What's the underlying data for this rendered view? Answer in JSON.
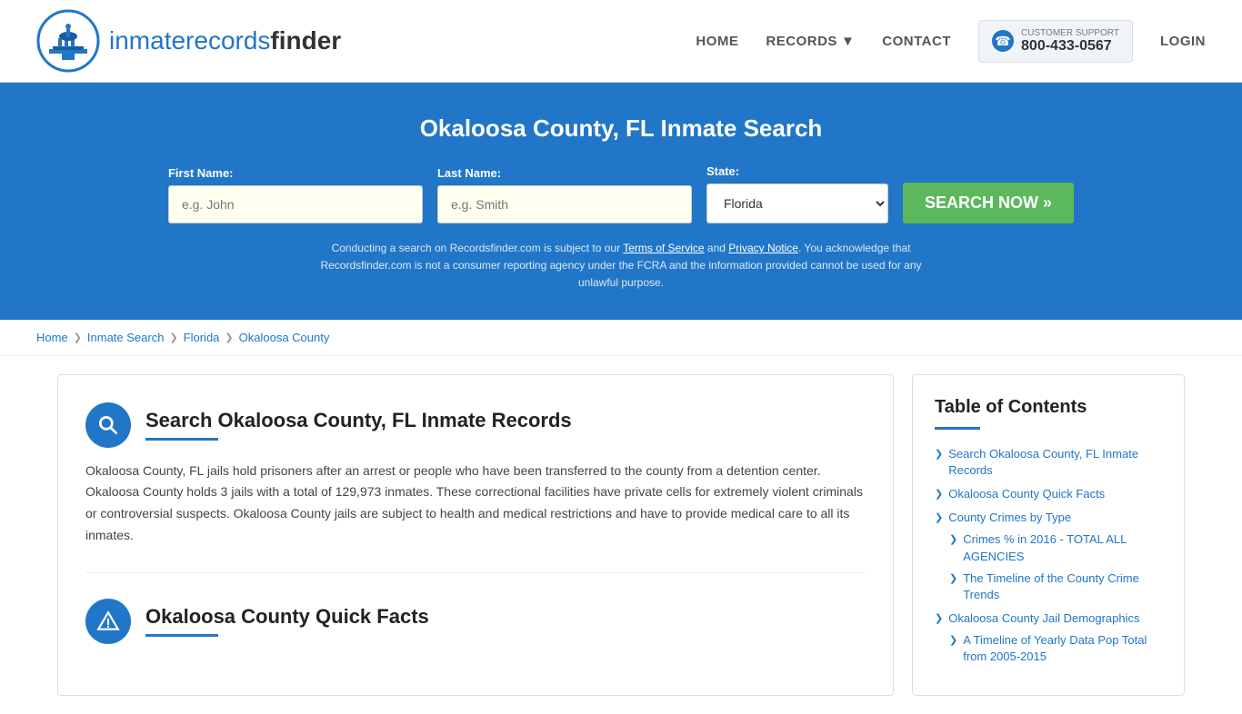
{
  "header": {
    "logo_text_part1": "inmaterecords",
    "logo_text_part2": "finder",
    "nav": {
      "home": "HOME",
      "records": "RECORDS",
      "contact": "CONTACT",
      "support_label": "CUSTOMER SUPPORT",
      "support_number": "800-433-0567",
      "login": "LOGIN"
    }
  },
  "hero": {
    "title": "Okaloosa County, FL Inmate Search",
    "form": {
      "first_name_label": "First Name:",
      "first_name_placeholder": "e.g. John",
      "last_name_label": "Last Name:",
      "last_name_placeholder": "e.g. Smith",
      "state_label": "State:",
      "state_value": "Florida",
      "search_button": "SEARCH NOW »"
    },
    "disclaimer": "Conducting a search on Recordsfinder.com is subject to our Terms of Service and Privacy Notice. You acknowledge that Recordsfinder.com is not a consumer reporting agency under the FCRA and the information provided cannot be used for any unlawful purpose."
  },
  "breadcrumb": {
    "home": "Home",
    "inmate_search": "Inmate Search",
    "florida": "Florida",
    "county": "Okaloosa County"
  },
  "main": {
    "section1": {
      "title": "Search Okaloosa County, FL Inmate Records",
      "body": "Okaloosa County, FL jails hold prisoners after an arrest or people who have been transferred to the county from a detention center. Okaloosa County holds 3 jails with a total of 129,973 inmates. These correctional facilities have private cells for extremely violent criminals or controversial suspects. Okaloosa County jails are subject to health and medical restrictions and have to provide medical care to all its inmates."
    },
    "section2": {
      "title": "Okaloosa County Quick Facts"
    }
  },
  "toc": {
    "title": "Table of Contents",
    "items": [
      {
        "label": "Search Okaloosa County, FL Inmate Records",
        "sub": false
      },
      {
        "label": "Okaloosa County Quick Facts",
        "sub": false
      },
      {
        "label": "County Crimes by Type",
        "sub": false
      },
      {
        "label": "Crimes % in 2016 - TOTAL ALL AGENCIES",
        "sub": true
      },
      {
        "label": "The Timeline of the County Crime Trends",
        "sub": true
      },
      {
        "label": "Okaloosa County Jail Demographics",
        "sub": false
      },
      {
        "label": "A Timeline of Yearly Data Pop Total from 2005-2015",
        "sub": true
      }
    ]
  }
}
